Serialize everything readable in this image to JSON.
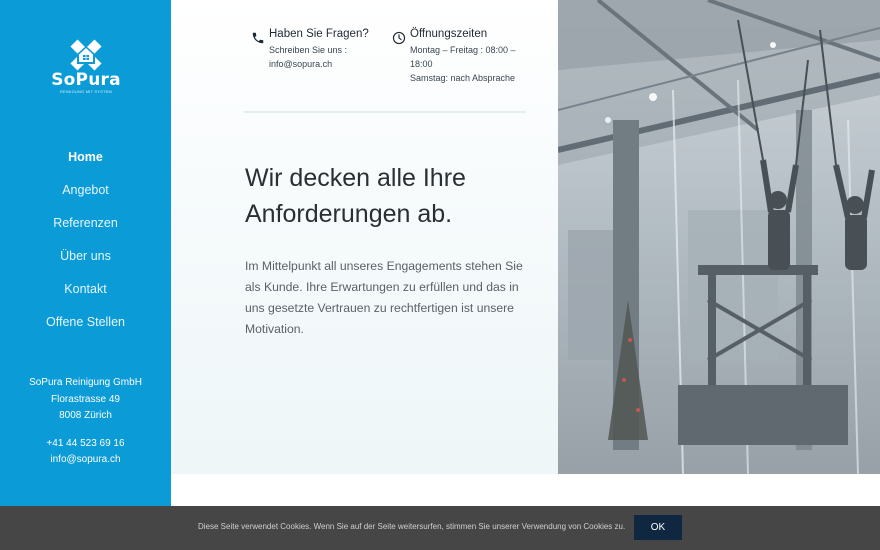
{
  "brand": {
    "name": "SoPura",
    "tagline": "REINIGUNG MIT SYSTEM",
    "logo_icon": "house-cross-logo",
    "color": "#0b9bd6"
  },
  "nav": {
    "items": [
      {
        "label": "Home",
        "active": true
      },
      {
        "label": "Angebot"
      },
      {
        "label": "Referenzen"
      },
      {
        "label": "Über uns"
      },
      {
        "label": "Kontakt"
      },
      {
        "label": "Offene Stellen"
      }
    ]
  },
  "company": {
    "name": "SoPura Reinigung GmbH",
    "street": "Florastrasse 49",
    "city": "8008 Zürich",
    "phone": "+41 44 523 69 16",
    "email": "info@sopura.ch"
  },
  "info": {
    "questions": {
      "icon": "phone-icon",
      "title": "Haben Sie Fragen?",
      "line1": "Schreiben Sie uns :",
      "line2": "info@sopura.ch"
    },
    "hours": {
      "icon": "clock-icon",
      "title": "Öffnungszeiten",
      "line1": "Montag – Freitag : 08:00 –",
      "line2": "18:00",
      "line3": "Samstag: nach Absprache"
    }
  },
  "hero": {
    "headline": "Wir decken alle Ihre Anforderungen ab.",
    "text": "Im Mittelpunkt all unseres Engagements stehen Sie als Kunde. Ihre Erwartungen zu erfüllen und das in uns gesetzte Vertrauen zu rechtfertigen ist unsere Motivation."
  },
  "cookie": {
    "text": "Diese Seite verwendet Cookies. Wenn Sie auf der Seite weitersurfen, stimmen Sie unserer Verwendung von Cookies zu.",
    "ok_label": "OK"
  }
}
